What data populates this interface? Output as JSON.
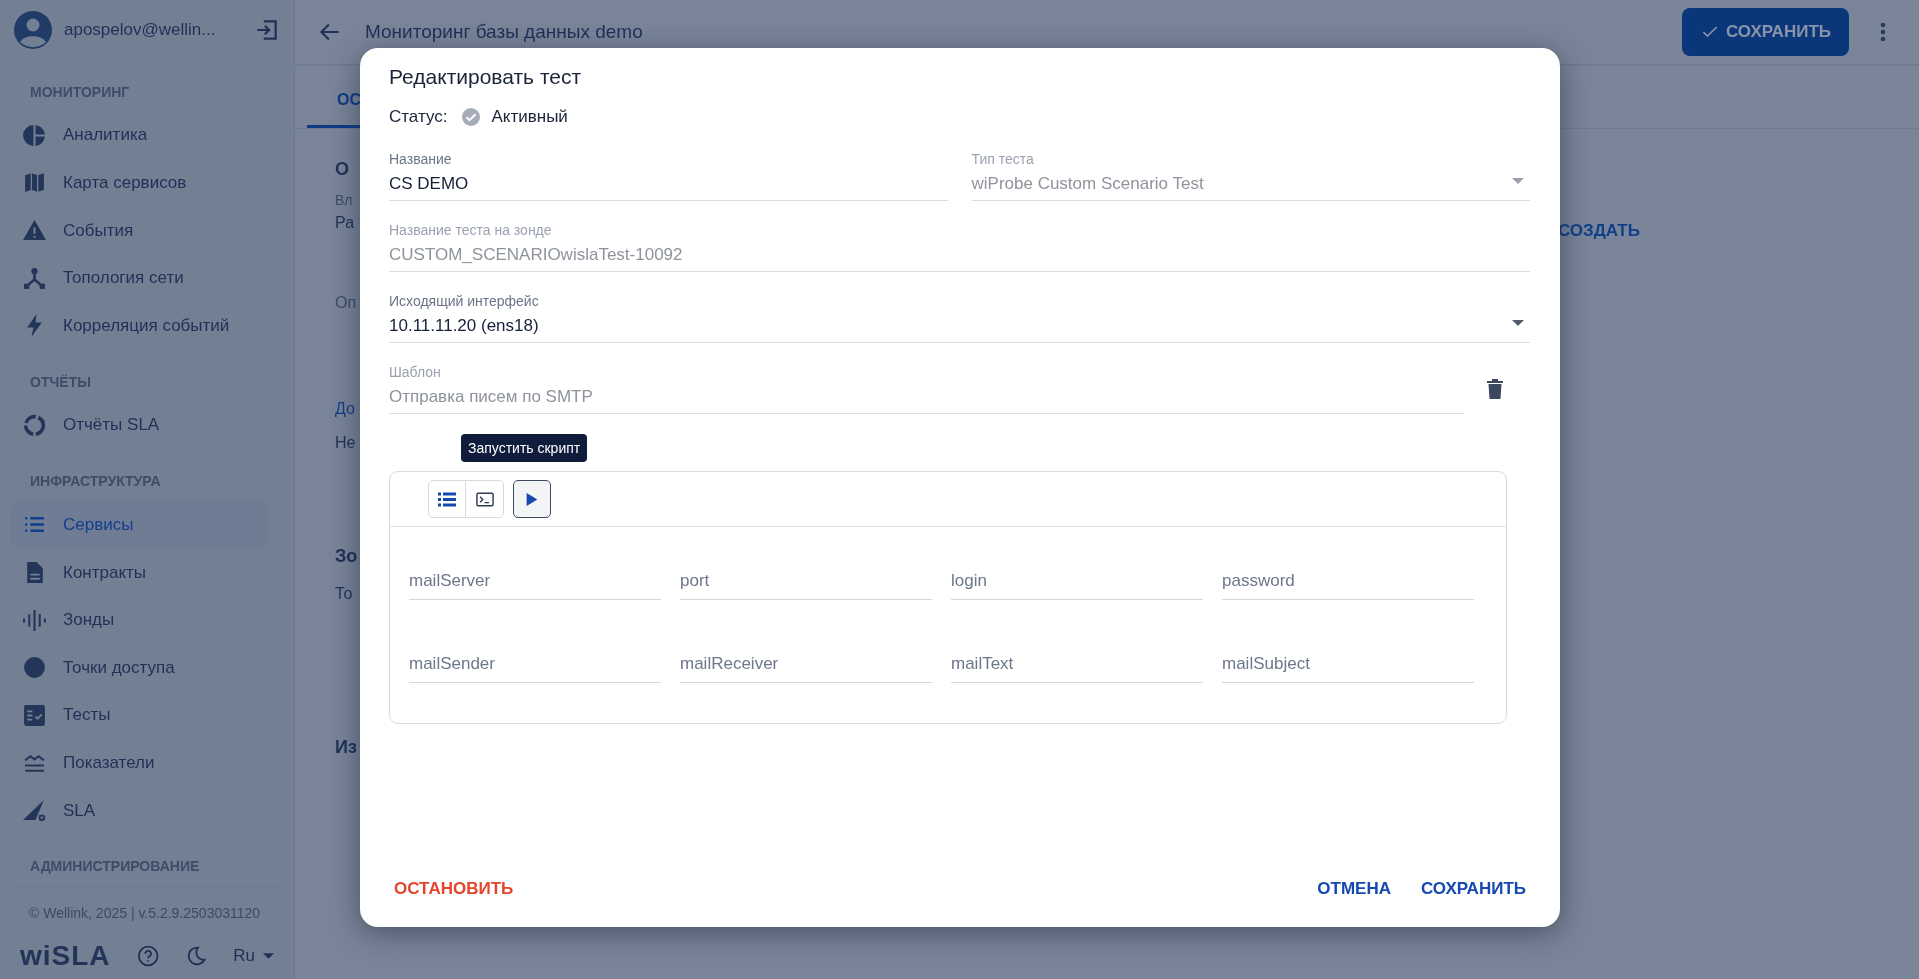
{
  "sidebar": {
    "user": "apospelov@wellin...",
    "sections": [
      {
        "title": "МОНИТОРИНГ",
        "items": [
          {
            "label": "Аналитика",
            "kind": "pie",
            "selected": false
          },
          {
            "label": "Карта сервисов",
            "kind": "map",
            "selected": false
          },
          {
            "label": "События",
            "kind": "warning",
            "selected": false
          },
          {
            "label": "Топология сети",
            "kind": "topology",
            "selected": false
          },
          {
            "label": "Корреляция событий",
            "kind": "bolt",
            "selected": false
          }
        ]
      },
      {
        "title": "ОТЧЁТЫ",
        "items": [
          {
            "label": "Отчёты SLA",
            "kind": "ring",
            "selected": false
          }
        ]
      },
      {
        "title": "ИНФРАСТРУКТУРА",
        "items": [
          {
            "label": "Сервисы",
            "kind": "list",
            "selected": true
          },
          {
            "label": "Контракты",
            "kind": "document",
            "selected": false
          },
          {
            "label": "Зонды",
            "kind": "wave",
            "selected": false
          },
          {
            "label": "Точки доступа",
            "kind": "dot",
            "selected": false
          },
          {
            "label": "Тесты",
            "kind": "checklist",
            "selected": false
          },
          {
            "label": "Показатели",
            "kind": "metrics",
            "selected": false
          },
          {
            "label": "SLA",
            "kind": "sla",
            "selected": false
          }
        ]
      },
      {
        "title": "АДМИНИСТРИРОВАНИЕ"
      }
    ],
    "copyright": "© Wellink, 2025 | v.5.2.9.2503031120",
    "logo": "wiSLA",
    "language": "Ru"
  },
  "header": {
    "title": "Мониторинг базы данных demo",
    "save_button": "СОХРАНИТЬ"
  },
  "background": {
    "tab": "ОС",
    "create_link": "СОЗДАТЬ",
    "fragments": [
      {
        "kind": "heading",
        "text": "О"
      },
      {
        "kind": "label",
        "text": "Вл"
      },
      {
        "kind": "value",
        "text": "Ра"
      },
      {
        "kind": "muted",
        "text": "Оп"
      },
      {
        "kind": "link",
        "text": "До"
      },
      {
        "kind": "value",
        "text": "Не"
      },
      {
        "kind": "heading",
        "text": "Зо"
      },
      {
        "kind": "value",
        "text": "То"
      },
      {
        "kind": "heading",
        "text": "Из"
      }
    ]
  },
  "dialog": {
    "title": "Редактировать тест",
    "status_label": "Статус:",
    "status_value": "Активный",
    "fields": [
      {
        "label": "Название",
        "value": "CS DEMO",
        "disabled": false,
        "dropdown": false,
        "deletable": false,
        "half": true
      },
      {
        "label": "Тип теста",
        "value": "wiProbe Custom Scenario Test",
        "disabled": true,
        "dropdown": true,
        "deletable": false,
        "half": true
      },
      {
        "label": "Название теста на зонде",
        "value": "CUSTOM_SCENARIOwislaTest-10092",
        "disabled": true,
        "dropdown": false,
        "deletable": false,
        "half": false
      },
      {
        "label": "Исходящий интерфейс",
        "value": "10.11.11.20 (ens18)",
        "disabled": false,
        "dropdown": true,
        "deletable": false,
        "half": false
      },
      {
        "label": "Шаблон",
        "value": "Отправка писем по SMTP",
        "disabled": true,
        "dropdown": false,
        "deletable": true,
        "half": false
      }
    ],
    "tooltip": "Запустить скрипт",
    "toolbar": [
      {
        "kind": "list",
        "focused": false
      },
      {
        "kind": "terminal",
        "focused": false
      },
      {
        "kind": "play",
        "focused": true
      }
    ],
    "params": [
      {
        "placeholder": "mailServer"
      },
      {
        "placeholder": "port"
      },
      {
        "placeholder": "login"
      },
      {
        "placeholder": "password"
      },
      {
        "placeholder": "mailSender"
      },
      {
        "placeholder": "mailReceiver"
      },
      {
        "placeholder": "mailText"
      },
      {
        "placeholder": "mailSubject"
      }
    ],
    "stop_button": "ОСТАНОВИТЬ",
    "cancel_button": "ОТМЕНА",
    "save_button": "СОХРАНИТЬ"
  }
}
